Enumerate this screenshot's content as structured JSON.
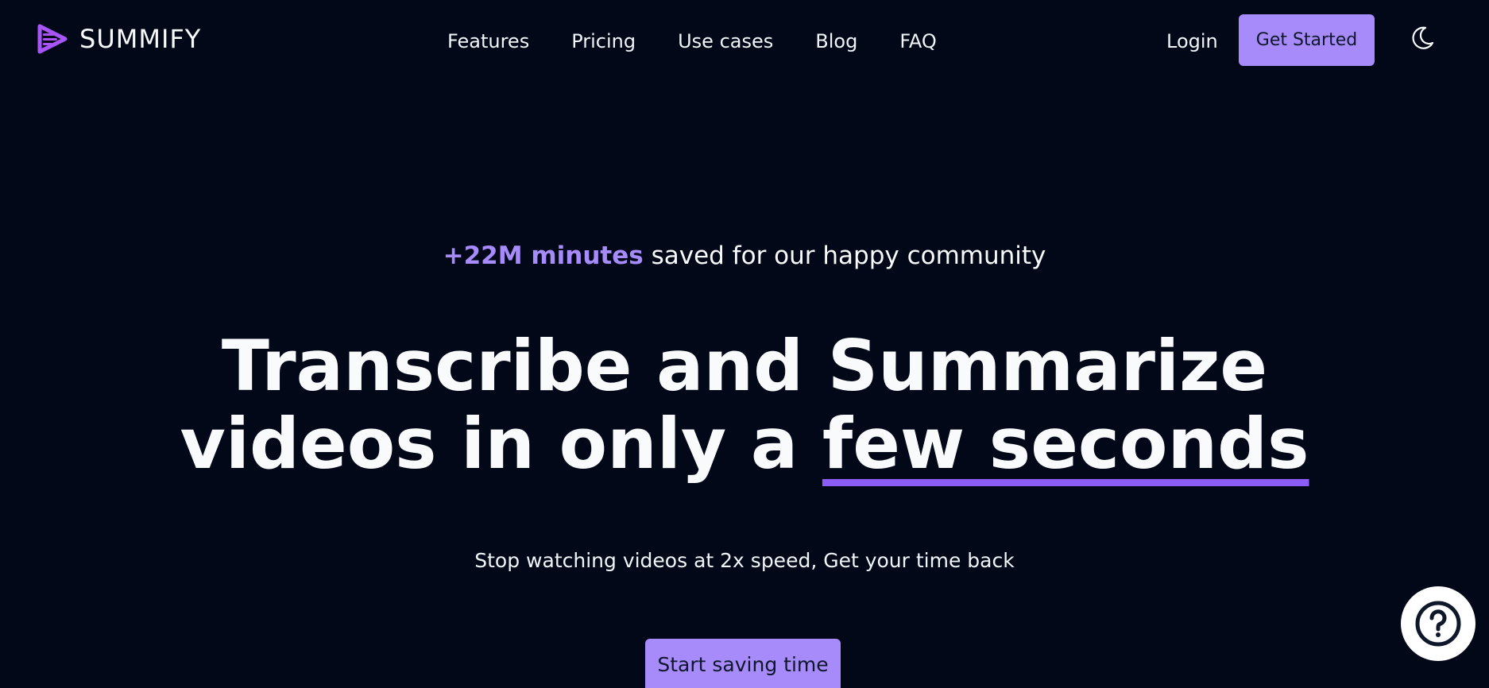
{
  "brand": {
    "name": "SUMMIFY",
    "accent_color": "#a78bfa",
    "background_color": "#020817"
  },
  "nav": {
    "links": [
      {
        "label": "Features"
      },
      {
        "label": "Pricing"
      },
      {
        "label": "Use cases"
      },
      {
        "label": "Blog"
      },
      {
        "label": "FAQ"
      }
    ],
    "login_label": "Login",
    "cta_label": "Get Started",
    "theme_toggle_icon": "moon-icon"
  },
  "hero": {
    "tagline_highlight": "+22M minutes",
    "tagline_rest": " saved for our happy community",
    "headline_line1": "Transcribe and Summarize",
    "headline_line2_start": "videos in only a ",
    "headline_line2_highlight": "few seconds",
    "subheadline": "Stop watching videos at 2x speed, Get your time back",
    "cta_label": "Start saving time"
  },
  "help": {
    "icon": "question-circle-icon"
  }
}
